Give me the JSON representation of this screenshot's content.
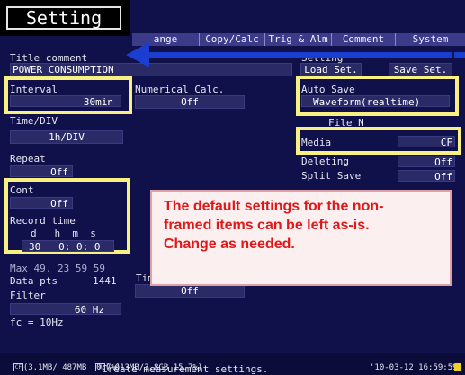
{
  "title": {
    "label": "Setting"
  },
  "tabs": [
    "ange",
    "Copy/Calc",
    "Trig & Alm",
    "Comment",
    "System"
  ],
  "title_comment": {
    "label": "Title comment",
    "value": "POWER CONSUMPTION"
  },
  "setting_group": {
    "label": "Setting",
    "load": "Load Set.",
    "save": "Save Set."
  },
  "interval": {
    "label": "Interval",
    "value": "30min"
  },
  "numerical_calc": {
    "label": "Numerical Calc.",
    "value": "Off"
  },
  "auto_save": {
    "label": "Auto Save",
    "value": "Waveform(realtime)"
  },
  "time_div": {
    "label": "Time/DIV",
    "value": "1h/DIV"
  },
  "file_n": {
    "label": "File N"
  },
  "media": {
    "label": "Media",
    "value": "CF"
  },
  "repeat": {
    "label": "Repeat",
    "value": "Off"
  },
  "deleting": {
    "label": "Deleting",
    "value": "Off"
  },
  "split_save": {
    "label": "Split Save",
    "value": "Off"
  },
  "cont": {
    "label": "Cont",
    "value": "Off"
  },
  "record_time": {
    "label": "Record time",
    "units": "d   h  m  s",
    "value": "30   0: 0: 0"
  },
  "max": {
    "label": "Max 49. 23 59 59"
  },
  "data_pts": {
    "label": "Data pts",
    "value": "1441"
  },
  "time_window": {
    "label": "Time",
    "value": "Off"
  },
  "filter": {
    "label": "Filter",
    "value": "60 Hz",
    "fc": "fc = 10Hz"
  },
  "note": "The default settings for the non-\nframed items can be left as-is.\nChange as needed.",
  "status": {
    "cf": "(3.1MB/ 487MB  0.7%)",
    "usb": "( 613MB/3.8GB 15.7%)",
    "hint": "Create measurement settings.",
    "datetime": "'10-03-12 16:59:59"
  },
  "colors": {
    "highlight_frame": "#f8f080",
    "arrow": "#1a3fd0",
    "note_text": "#e01818"
  }
}
